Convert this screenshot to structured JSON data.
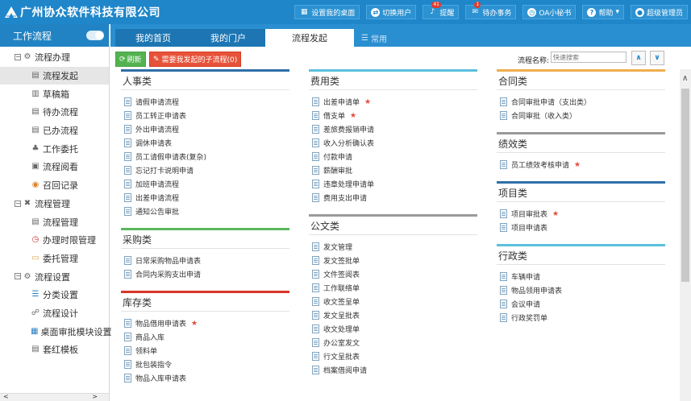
{
  "app": {
    "logo_text": "广州协众软件科技有限公司"
  },
  "topbar": {
    "items": [
      {
        "label": "设置我的桌面",
        "icon": "desktop-grid-icon"
      },
      {
        "label": "切换用户",
        "icon": "switch-user-icon"
      },
      {
        "label": "提醒",
        "icon": "bell-icon",
        "badge": "41"
      },
      {
        "label": "待办事务",
        "icon": "todo-icon",
        "badge": "1"
      },
      {
        "label": "OA小秘书",
        "icon": "clock-icon"
      },
      {
        "label": "帮助",
        "icon": "help-icon"
      },
      {
        "label": "超级管理员",
        "icon": "user-icon"
      }
    ]
  },
  "sidebar": {
    "title": "工作流程",
    "items": [
      {
        "label": "流程办理",
        "level": "group",
        "expanded": "⊟",
        "icon": "gear-icon"
      },
      {
        "label": "流程发起",
        "level": "sub",
        "icon": "flow-start-icon",
        "active": true
      },
      {
        "label": "草稿箱",
        "level": "sub",
        "icon": "draft-icon"
      },
      {
        "label": "待办流程",
        "level": "sub",
        "icon": "todo-flow-icon"
      },
      {
        "label": "已办流程",
        "level": "sub",
        "icon": "done-flow-icon"
      },
      {
        "label": "工作委托",
        "level": "sub",
        "icon": "delegate-icon"
      },
      {
        "label": "流程阅看",
        "level": "sub",
        "icon": "view-flow-icon"
      },
      {
        "label": "召回记录",
        "level": "sub",
        "icon": "recall-icon"
      },
      {
        "label": "流程管理",
        "level": "group",
        "expanded": "⊟",
        "icon": "tools-icon"
      },
      {
        "label": "流程管理",
        "level": "sub",
        "icon": "manage-icon"
      },
      {
        "label": "办理时限管理",
        "level": "sub",
        "icon": "timer-icon"
      },
      {
        "label": "委托管理",
        "level": "sub",
        "icon": "folder-icon"
      },
      {
        "label": "流程设置",
        "level": "group",
        "expanded": "⊟",
        "icon": "settings-icon"
      },
      {
        "label": "分类设置",
        "level": "sub",
        "icon": "category-icon"
      },
      {
        "label": "流程设计",
        "level": "sub",
        "icon": "design-icon"
      },
      {
        "label": "桌面审批模块设置",
        "level": "sub",
        "icon": "module-icon"
      },
      {
        "label": "套红模板",
        "level": "sub",
        "icon": "template-icon"
      }
    ]
  },
  "tabs": [
    {
      "label": "我的首页"
    },
    {
      "label": "我的门户"
    },
    {
      "label": "流程发起",
      "active": true
    },
    {
      "label": "常用"
    }
  ],
  "toolbar": {
    "refresh": "刷新",
    "sub_flow": "需要我发起的子流程(0)",
    "flow_name_label": "流程名称:",
    "search_placeholder": "快速搜索"
  },
  "columns": [
    {
      "categories": [
        {
          "title": "人事类",
          "color": "#2f6fa8",
          "items": [
            {
              "label": "请假申请流程"
            },
            {
              "label": "员工转正申请表"
            },
            {
              "label": "外出申请流程"
            },
            {
              "label": "调休申请表"
            },
            {
              "label": "员工请假申请表(复杂)"
            },
            {
              "label": "忘记打卡说明申请"
            },
            {
              "label": "加班申请流程"
            },
            {
              "label": "出差申请流程"
            },
            {
              "label": "通知公告审批"
            }
          ]
        },
        {
          "title": "采购类",
          "color": "#5cb85c",
          "items": [
            {
              "label": "日常采购物品申请表"
            },
            {
              "label": "合同内采购支出申请"
            }
          ]
        },
        {
          "title": "库存类",
          "color": "#d9362b",
          "items": [
            {
              "label": "物品借用申请表",
              "star": true
            },
            {
              "label": "商品入库"
            },
            {
              "label": "领料单"
            },
            {
              "label": "批包装指令"
            },
            {
              "label": "物品入库申请表"
            }
          ]
        }
      ]
    },
    {
      "categories": [
        {
          "title": "费用类",
          "color": "#5bc0de",
          "items": [
            {
              "label": "出差申请单",
              "star": true
            },
            {
              "label": "借支单",
              "star": true
            },
            {
              "label": "差旅费报销申请"
            },
            {
              "label": "收入分析确认表"
            },
            {
              "label": "付款申请"
            },
            {
              "label": "薪酬审批"
            },
            {
              "label": "违章处理申请单"
            },
            {
              "label": "费用支出申请"
            }
          ]
        },
        {
          "title": "公文类",
          "color": "#9a9a9a",
          "items": [
            {
              "label": "发文管理"
            },
            {
              "label": "发文签批单"
            },
            {
              "label": "文件签阅表"
            },
            {
              "label": "工作联络单"
            },
            {
              "label": "收文签呈单"
            },
            {
              "label": "发文呈批表"
            },
            {
              "label": "收文处理单"
            },
            {
              "label": "办公室发文"
            },
            {
              "label": "行文呈批表"
            },
            {
              "label": "档案借阅申请"
            }
          ]
        }
      ]
    },
    {
      "categories": [
        {
          "title": "合同类",
          "color": "#f0ad4e",
          "items": [
            {
              "label": "合同审批申请（支出类）"
            },
            {
              "label": "合同审批（收入类）"
            }
          ]
        },
        {
          "title": "绩效类",
          "color": "#9a9a9a",
          "items": [
            {
              "label": "员工绩效考核申请",
              "star": true
            }
          ]
        },
        {
          "title": "项目类",
          "color": "#2f6fa8",
          "items": [
            {
              "label": "项目审批表",
              "star": true
            },
            {
              "label": "项目申请表"
            }
          ]
        },
        {
          "title": "行政类",
          "color": "#5bc0de",
          "items": [
            {
              "label": "车辆申请"
            },
            {
              "label": "物品领用申请表"
            },
            {
              "label": "会议申请"
            },
            {
              "label": "行政奖罚单"
            }
          ]
        }
      ]
    }
  ]
}
